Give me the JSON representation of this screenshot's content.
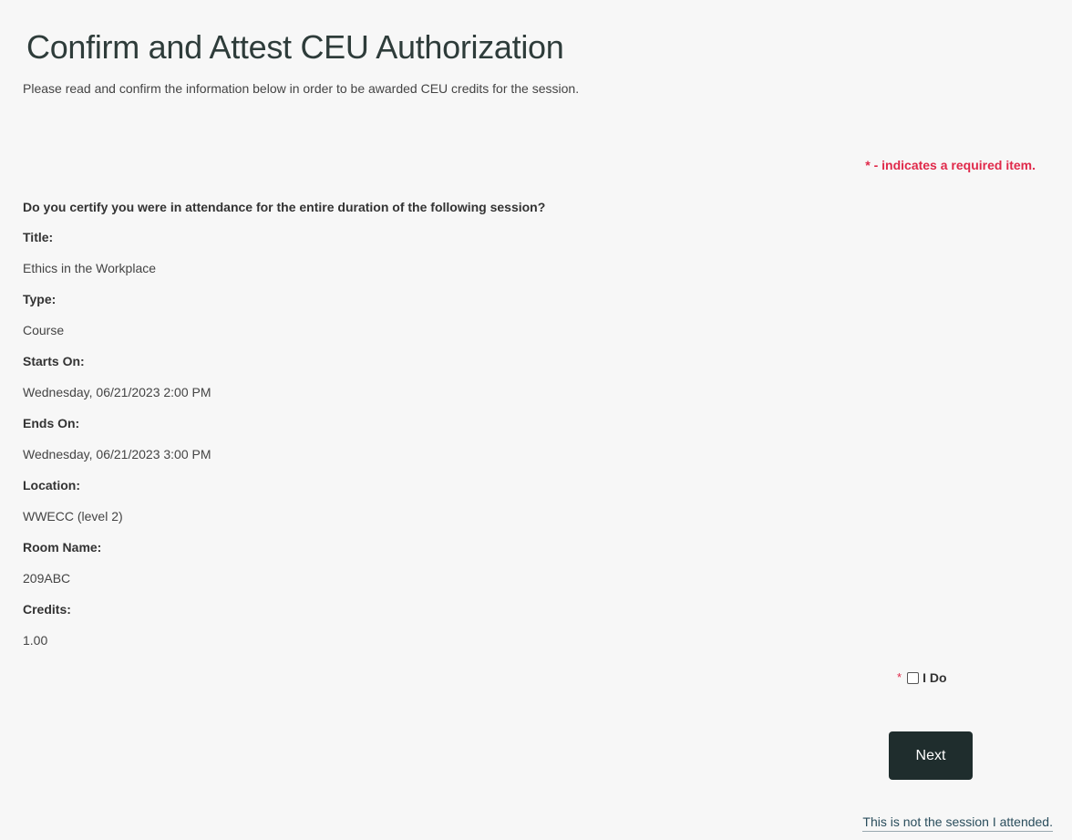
{
  "header": {
    "title": "Confirm and Attest CEU Authorization",
    "subtitle": "Please read and confirm the information below in order to be awarded CEU credits for the session."
  },
  "form": {
    "required_note": "* - indicates a required item.",
    "question": "Do you certify you were in attendance for the entire duration of the following session?",
    "details": [
      {
        "label": "Title:",
        "value": "Ethics in the Workplace"
      },
      {
        "label": "Type:",
        "value": "Course"
      },
      {
        "label": "Starts On:",
        "value": "Wednesday, 06/21/2023 2:00 PM"
      },
      {
        "label": "Ends On:",
        "value": "Wednesday, 06/21/2023 3:00 PM"
      },
      {
        "label": "Location:",
        "value": "WWECC (level 2)"
      },
      {
        "label": "Room Name:",
        "value": "209ABC"
      },
      {
        "label": "Credits:",
        "value": "1.00"
      }
    ],
    "attest": {
      "required_marker": "*",
      "label": "I Do",
      "checked": false
    },
    "next_label": "Next",
    "alt_link": "This is not the session I attended."
  },
  "colors": {
    "background": "#f7f7f7",
    "title": "#2e3c3a",
    "required": "#e0294a",
    "button": "#1f2d2d",
    "link": "#2a4d5c"
  }
}
